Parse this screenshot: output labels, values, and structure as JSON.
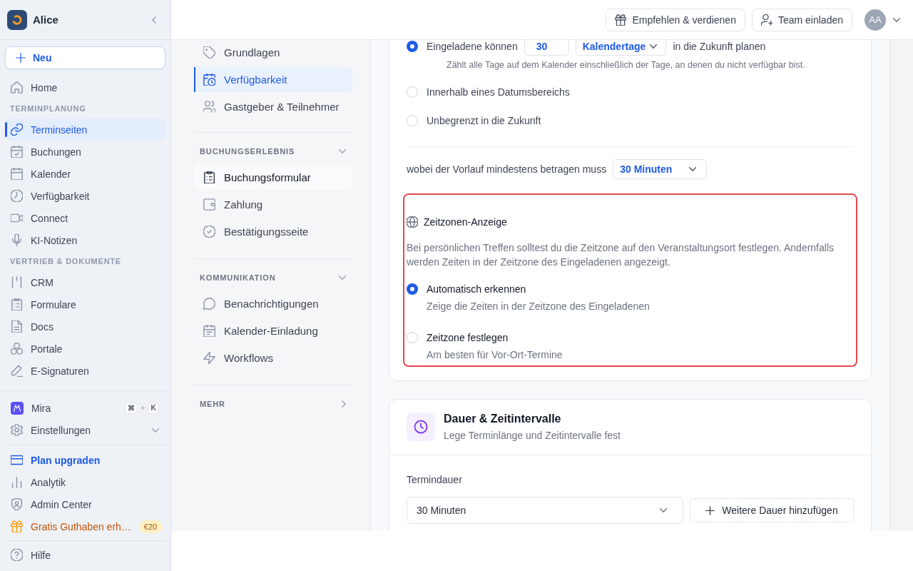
{
  "sidebar": {
    "workspace": "Alice",
    "new_button": "Neu",
    "sections": [
      {
        "items": [
          {
            "label": "Home",
            "selected": false
          }
        ]
      },
      {
        "title": "TERMINPLANUNG",
        "items": [
          {
            "label": "Terminseiten",
            "selected": true
          },
          {
            "label": "Buchungen",
            "selected": false
          },
          {
            "label": "Kalender",
            "selected": false
          },
          {
            "label": "Verfügbarkeit",
            "selected": false
          },
          {
            "label": "Connect",
            "selected": false
          },
          {
            "label": "KI-Notizen",
            "selected": false
          }
        ]
      },
      {
        "title": "VERTRIEB & DOKUMENTE",
        "items": [
          {
            "label": "CRM",
            "selected": false
          },
          {
            "label": "Formulare",
            "selected": false
          },
          {
            "label": "Docs",
            "selected": false
          },
          {
            "label": "Portale",
            "selected": false
          },
          {
            "label": "E-Signaturen",
            "selected": false
          }
        ]
      }
    ],
    "bottom_groups": [
      {
        "items": [
          {
            "kind": "assistant",
            "label": "Mira",
            "shortcut_keys": [
              "⌘",
              "K"
            ],
            "shortcut_joiner": "+"
          },
          {
            "kind": "menu",
            "label": "Einstellungen",
            "expanded": false
          }
        ]
      },
      {
        "items": [
          {
            "kind": "upgrade",
            "label": "Plan upgraden"
          },
          {
            "kind": "link",
            "label": "Analytik"
          },
          {
            "kind": "link",
            "label": "Admin Center"
          },
          {
            "kind": "promo",
            "label": "Gratis Guthaben erh…",
            "badge": "€20"
          }
        ]
      },
      {
        "items": [
          {
            "kind": "link",
            "label": "Hilfe"
          }
        ]
      }
    ]
  },
  "top_bar": {
    "buttons": [
      {
        "label": "Empfehlen & verdienen"
      },
      {
        "label": "Team einladen"
      }
    ],
    "avatar": {
      "initials": "AA"
    }
  },
  "settings_nav": {
    "sections": [
      {
        "items": [
          {
            "label": "Grundlagen",
            "selected": false,
            "hovered": false
          },
          {
            "label": "Verfügbarkeit",
            "selected": true,
            "hovered": false
          },
          {
            "label": "Gastgeber & Teilnehmer",
            "selected": false,
            "hovered": false
          }
        ]
      },
      {
        "title": "BUCHUNGSERLEBNIS",
        "expanded": true,
        "items": [
          {
            "label": "Buchungsformular",
            "selected": false,
            "hovered": true
          },
          {
            "label": "Zahlung",
            "selected": false,
            "hovered": false
          },
          {
            "label": "Bestätigungsseite",
            "selected": false,
            "hovered": false
          }
        ]
      },
      {
        "title": "KOMMUNIKATION",
        "expanded": true,
        "items": [
          {
            "label": "Benachrichtigungen",
            "selected": false,
            "hovered": false
          },
          {
            "label": "Kalender-Einladung",
            "selected": false,
            "hovered": false
          },
          {
            "label": "Workflows",
            "selected": false,
            "hovered": false
          }
        ]
      },
      {
        "title": "MEHR",
        "expanded": false
      }
    ]
  },
  "availability": {
    "options": [
      {
        "kind": "rolling",
        "selected": true,
        "text_before": "Eingeladene können",
        "days": "30",
        "unit": "Kalendertage",
        "text_after": "in die Zukunft planen",
        "hint": "Zählt alle Tage auf dem Kalender einschließlich der Tage, an denen du nicht verfügbar bist."
      },
      {
        "kind": "plain",
        "selected": false,
        "label": "Innerhalb eines Datumsbereichs"
      },
      {
        "kind": "plain",
        "selected": false,
        "label": "Unbegrenzt in die Zukunft"
      }
    ],
    "minimum_notice": {
      "label": "wobei der Vorlauf mindestens betragen muss",
      "value": "30 Minuten"
    }
  },
  "timezone_display": {
    "highlighted": true,
    "title": "Zeitzonen-Anzeige",
    "description": "Bei persönlichen Treffen solltest du die Zeitzone auf den Veranstaltungsort festlegen. Andernfalls werden Zeiten in der Zeitzone des Eingeladenen angezeigt.",
    "options": [
      {
        "label": "Automatisch erkennen",
        "description": "Zeige die Zeiten in der Zeitzone des Eingeladenen",
        "selected": true
      },
      {
        "label": "Zeitzone festlegen",
        "description": "Am besten für Vor-Ort-Termine",
        "selected": false
      }
    ]
  },
  "duration": {
    "title": "Dauer & Zeitintervalle",
    "subtitle": "Lege Terminlänge und Zeitintervalle fest",
    "field_label": "Termindauer",
    "value": "30 Minuten",
    "add_button": "Weitere Dauer hinzufügen"
  }
}
